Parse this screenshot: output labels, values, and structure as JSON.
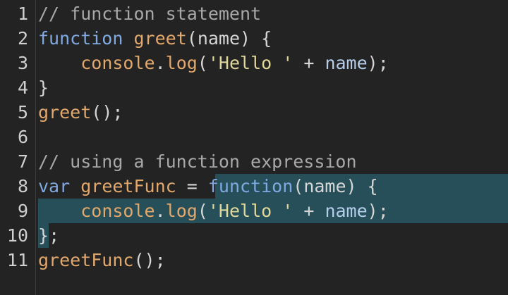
{
  "editor": {
    "language": "javascript",
    "selection_color": "#264f5a",
    "lines": [
      {
        "number": "1",
        "tokens": [
          {
            "text": "// function statement",
            "kind": "comment"
          }
        ]
      },
      {
        "number": "2",
        "tokens": [
          {
            "text": "function",
            "kind": "keyword"
          },
          {
            "text": " ",
            "kind": "plain"
          },
          {
            "text": "greet",
            "kind": "function"
          },
          {
            "text": "(",
            "kind": "plain"
          },
          {
            "text": "name",
            "kind": "plain"
          },
          {
            "text": ") {",
            "kind": "plain"
          }
        ]
      },
      {
        "number": "3",
        "tokens": [
          {
            "text": "    ",
            "kind": "plain"
          },
          {
            "text": "console",
            "kind": "function"
          },
          {
            "text": ".",
            "kind": "plain"
          },
          {
            "text": "log",
            "kind": "function"
          },
          {
            "text": "(",
            "kind": "plain"
          },
          {
            "text": "'Hello '",
            "kind": "string"
          },
          {
            "text": " + ",
            "kind": "plain"
          },
          {
            "text": "name",
            "kind": "variable"
          },
          {
            "text": ");",
            "kind": "plain"
          }
        ]
      },
      {
        "number": "4",
        "tokens": [
          {
            "text": "}",
            "kind": "plain"
          }
        ]
      },
      {
        "number": "5",
        "tokens": [
          {
            "text": "greet",
            "kind": "function"
          },
          {
            "text": "();",
            "kind": "plain"
          }
        ]
      },
      {
        "number": "6",
        "tokens": []
      },
      {
        "number": "7",
        "tokens": [
          {
            "text": "// using a function expression",
            "kind": "comment"
          }
        ]
      },
      {
        "number": "8",
        "selected": "partial",
        "tokens": [
          {
            "text": "var",
            "kind": "keyword"
          },
          {
            "text": " ",
            "kind": "plain"
          },
          {
            "text": "greetFunc",
            "kind": "function"
          },
          {
            "text": " = ",
            "kind": "plain"
          },
          {
            "text": "function",
            "kind": "keyword"
          },
          {
            "text": "(",
            "kind": "plain"
          },
          {
            "text": "name",
            "kind": "plain"
          },
          {
            "text": ") {",
            "kind": "plain"
          }
        ]
      },
      {
        "number": "9",
        "selected": "full",
        "tokens": [
          {
            "text": "    ",
            "kind": "plain"
          },
          {
            "text": "console",
            "kind": "function"
          },
          {
            "text": ".",
            "kind": "plain"
          },
          {
            "text": "log",
            "kind": "function"
          },
          {
            "text": "(",
            "kind": "plain"
          },
          {
            "text": "'Hello '",
            "kind": "string"
          },
          {
            "text": " + ",
            "kind": "plain"
          },
          {
            "text": "name",
            "kind": "variable"
          },
          {
            "text": ");",
            "kind": "plain"
          }
        ]
      },
      {
        "number": "10",
        "selected": "end",
        "tokens": [
          {
            "text": "}",
            "kind": "plain"
          },
          {
            "text": ";",
            "kind": "plain"
          }
        ]
      },
      {
        "number": "11",
        "tokens": [
          {
            "text": "greetFunc",
            "kind": "function"
          },
          {
            "text": "();",
            "kind": "plain"
          }
        ]
      }
    ]
  }
}
